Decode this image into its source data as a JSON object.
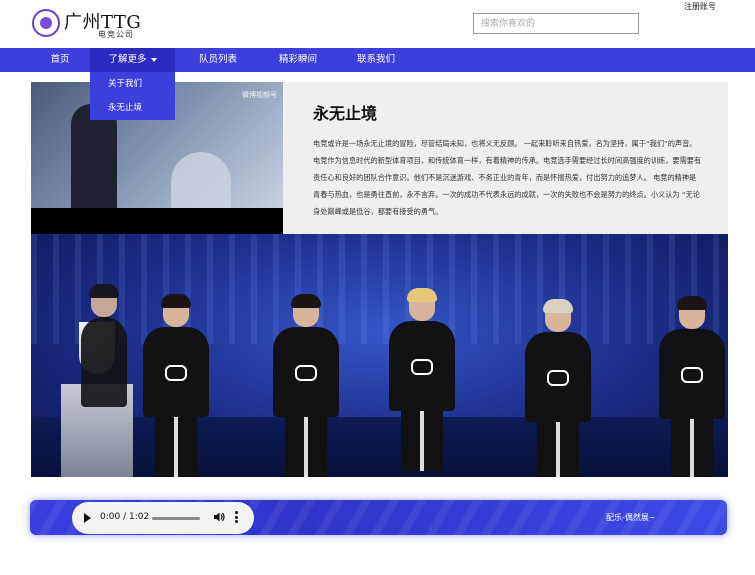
{
  "header": {
    "brand_title": "广州TTG",
    "brand_subtitle": "电竞公司",
    "search_placeholder": "搜索你喜欢的",
    "register_link": "注册账号"
  },
  "nav": {
    "items": [
      {
        "label": "首页"
      },
      {
        "label": "了解更多"
      },
      {
        "label": "队员列表"
      },
      {
        "label": "精彩瞬间"
      },
      {
        "label": "联系我们"
      }
    ],
    "dropdown": [
      {
        "label": "关于我们"
      },
      {
        "label": "永无止境"
      }
    ]
  },
  "video": {
    "watermark": "微博视频号"
  },
  "article": {
    "title": "永无止境",
    "body": "电竞或许是一场永无止境的冒险，尽管结局未知，也将义无反顾。 一起来聆听来自热爱，名为坚持，属于“我们”的声音。电竞作为信息时代的新型体育项目，和传统体育一样，有着精神的传承。电竞选手需要经过长时间高强度的训练，要需要有责任心和良好的团队合作意识。他们不是沉迷游戏、不务正业的青年，而是怀揣热爱，付出努力的追梦人。 电竞的精神是青春与热血，也是勇往直前，永不言弃。一次的成功不代表永远的成就，一次的失败也不会是努力的终点。小义认为 “无论身处巅峰或是低谷，都要有接受的勇气。"
  },
  "audio": {
    "time": "0:00 / 1:02",
    "progress": 0,
    "credit": "配乐-偶然展~"
  },
  "colors": {
    "nav_bg": "#3b3fdc",
    "nav_active": "#2a2cc0",
    "content_bg": "#efefef"
  }
}
